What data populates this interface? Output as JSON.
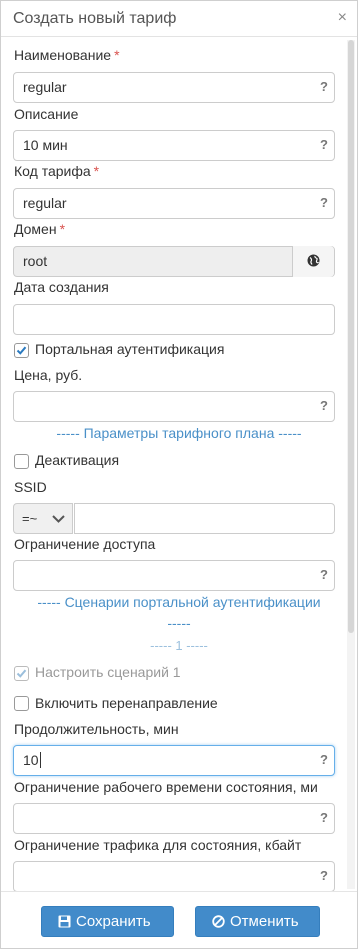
{
  "dialog": {
    "title": "Создать новый тариф",
    "close": "×"
  },
  "form": {
    "name": {
      "label": "Наименование",
      "required": "*",
      "value": "regular",
      "help": "?"
    },
    "description": {
      "label": "Описание",
      "value": "10 мин",
      "help": "?"
    },
    "code": {
      "label": "Код тарифа",
      "required": "*",
      "value": "regular",
      "help": "?"
    },
    "domain": {
      "label": "Домен",
      "required": "*",
      "value": "root"
    },
    "created": {
      "label": "Дата создания",
      "value": ""
    },
    "portal_auth": {
      "label": "Портальная аутентификация",
      "checked": true
    },
    "price": {
      "label": "Цена, руб.",
      "value": "",
      "help": "?"
    },
    "plan_section": "----- Параметры тарифного плана -----",
    "deactivation": {
      "label": "Деактивация",
      "checked": false
    },
    "ssid": {
      "label": "SSID",
      "operator": "=~",
      "value": ""
    },
    "access_limit": {
      "label": "Ограничение доступа",
      "value": "",
      "help": "?"
    },
    "scenarios_section_line1": "----- Сценарии портальной аутентификации",
    "scenarios_section_line2": "-----",
    "scenario_number": "----- 1 -----",
    "configure_scenario": {
      "label": "Настроить сценарий 1",
      "checked": true,
      "disabled": true
    },
    "redirect": {
      "label": "Включить перенаправление",
      "checked": false
    },
    "duration": {
      "label": "Продолжительность, мин",
      "value": "10",
      "help": "?"
    },
    "work_time_limit": {
      "label": "Ограничение рабочего времени состояния, ми",
      "value": "",
      "help": "?"
    },
    "traffic_limit": {
      "label": "Ограничение трафика для состояния, кбайт",
      "value": "",
      "help": "?"
    }
  },
  "footer": {
    "save_label": "Сохранить",
    "cancel_label": "Отменить"
  },
  "colors": {
    "primary": "#428bca",
    "link": "#4a90c8",
    "required": "#d9534f"
  }
}
